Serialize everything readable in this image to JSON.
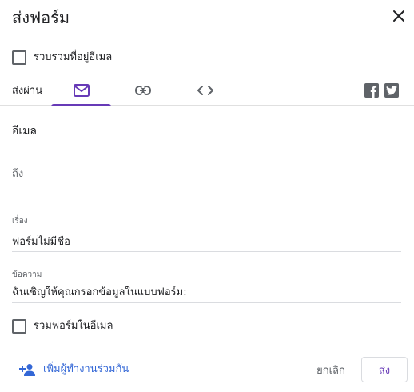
{
  "dialog": {
    "title": "ส่งฟอร์ม",
    "close_icon": "close-icon"
  },
  "collect_emails": {
    "label": "รวบรวมที่อยู่อีเมล",
    "checked": false
  },
  "send_via": {
    "label": "ส่งผ่าน",
    "tabs": [
      {
        "icon": "email-icon",
        "active": true
      },
      {
        "icon": "link-icon",
        "active": false
      },
      {
        "icon": "embed-code-icon",
        "active": false
      }
    ],
    "share": [
      {
        "icon": "facebook-icon"
      },
      {
        "icon": "twitter-icon"
      }
    ]
  },
  "email": {
    "section_title": "อีเมล",
    "to": {
      "placeholder": "ถึง",
      "value": ""
    },
    "subject": {
      "label": "เรื่อง",
      "value": "ฟอร์มไม่มีชื่อ"
    },
    "message": {
      "label": "ข้อความ",
      "value": "ฉันเชิญให้คุณกรอกข้อมูลในแบบฟอร์ม:"
    },
    "include_form": {
      "label": "รวมฟอร์มในอีเมล",
      "checked": false
    }
  },
  "footer": {
    "add_collaborators": "เพิ่มผู้ทำงานร่วมกัน",
    "cancel": "ยกเลิก",
    "send": "ส่ง"
  },
  "colors": {
    "accent": "#673ab7",
    "link": "#3367d6",
    "icon": "#5f6368"
  }
}
